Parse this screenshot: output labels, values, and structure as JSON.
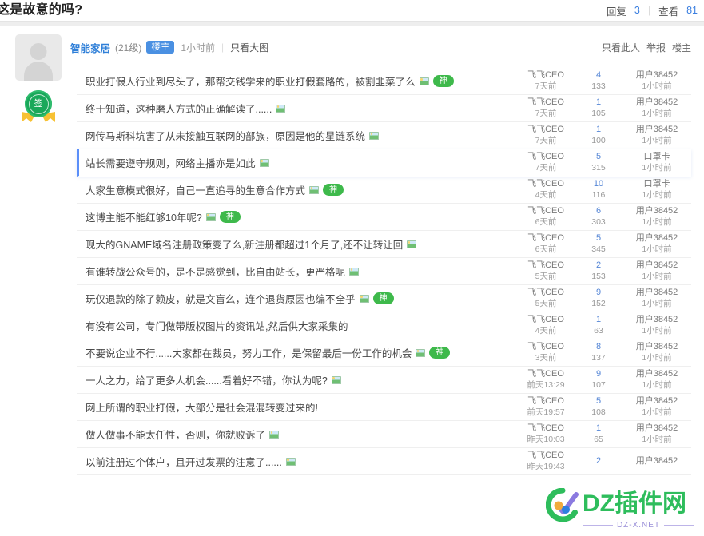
{
  "header": {
    "thread_title": "这是故意的吗?",
    "reply_label": "回复",
    "reply_count": "3",
    "view_label": "查看",
    "view_count": "81"
  },
  "post": {
    "author": "智能家居",
    "level": "(21级)",
    "lz_tag": "楼主",
    "time": "1小时前",
    "big_pic_link": "只看大图",
    "actions": {
      "only_this_user": "只看此人",
      "report": "举报",
      "lz": "楼主"
    },
    "avatar_name": "default-avatar",
    "badge_text": "签"
  },
  "colors": {
    "accent_blue": "#4a90e2",
    "link_blue": "#5586d6",
    "badge_green": "#3eb94b",
    "sign_green": "#1aa85a",
    "watermark_green": "#2ebd5c",
    "highlight_border": "#5b8ff9"
  },
  "threads": [
    {
      "title": "职业打假人行业到尽头了，那帮交钱学来的职业打假套路的，被割韭菜了么",
      "has_image": true,
      "god_badge": "神",
      "author": "飞飞CEO",
      "author_time": "7天前",
      "replies": "4",
      "views": "133",
      "last_user": "用户38452",
      "last_time": "1小时前",
      "active": false
    },
    {
      "title": "终于知道，这种磨人方式的正确解读了......",
      "has_image": true,
      "god_badge": "",
      "author": "飞飞CEO",
      "author_time": "7天前",
      "replies": "1",
      "views": "105",
      "last_user": "用户38452",
      "last_time": "1小时前",
      "active": false
    },
    {
      "title": "网传马斯科坑害了从未接触互联网的部族，原因是他的星链系统",
      "has_image": true,
      "god_badge": "",
      "author": "飞飞CEO",
      "author_time": "7天前",
      "replies": "1",
      "views": "100",
      "last_user": "用户38452",
      "last_time": "1小时前",
      "active": false
    },
    {
      "title": "站长需要遵守规则，网络主播亦是如此",
      "has_image": true,
      "god_badge": "",
      "author": "飞飞CEO",
      "author_time": "7天前",
      "replies": "5",
      "views": "315",
      "last_user": "口罩卡",
      "last_time": "1小时前",
      "active": true
    },
    {
      "title": "人家生意模式很好，自己一直追寻的生意合作方式",
      "has_image": true,
      "god_badge": "神",
      "author": "飞飞CEO",
      "author_time": "4天前",
      "replies": "10",
      "views": "116",
      "last_user": "口罩卡",
      "last_time": "1小时前",
      "active": false
    },
    {
      "title": "这博主能不能红够10年呢?",
      "has_image": true,
      "god_badge": "神",
      "author": "飞飞CEO",
      "author_time": "6天前",
      "replies": "6",
      "views": "303",
      "last_user": "用户38452",
      "last_time": "1小时前",
      "active": false
    },
    {
      "title": "现大的GNAME域名注册政策变了么,新注册都超过1个月了,还不让转让回",
      "has_image": true,
      "god_badge": "",
      "author": "飞飞CEO",
      "author_time": "6天前",
      "replies": "5",
      "views": "345",
      "last_user": "用户38452",
      "last_time": "1小时前",
      "active": false
    },
    {
      "title": "有谁转战公众号的，是不是感觉到，比自由站长，更严格呢",
      "has_image": true,
      "god_badge": "",
      "author": "飞飞CEO",
      "author_time": "5天前",
      "replies": "2",
      "views": "153",
      "last_user": "用户38452",
      "last_time": "1小时前",
      "active": false
    },
    {
      "title": "玩仅退款的除了赖皮，就是文盲么，连个退货原因也编不全乎",
      "has_image": true,
      "god_badge": "神",
      "author": "飞飞CEO",
      "author_time": "5天前",
      "replies": "9",
      "views": "152",
      "last_user": "用户38452",
      "last_time": "1小时前",
      "active": false
    },
    {
      "title": "有没有公司，专门做带版权图片的资讯站,然后供大家采集的",
      "has_image": false,
      "god_badge": "",
      "author": "飞飞CEO",
      "author_time": "4天前",
      "replies": "1",
      "views": "63",
      "last_user": "用户38452",
      "last_time": "1小时前",
      "active": false
    },
    {
      "title": "不要说企业不行......大家都在裁员，努力工作，是保留最后一份工作的机会",
      "has_image": true,
      "god_badge": "神",
      "author": "飞飞CEO",
      "author_time": "3天前",
      "replies": "8",
      "views": "137",
      "last_user": "用户38452",
      "last_time": "1小时前",
      "active": false
    },
    {
      "title": "一人之力，给了更多人机会......看着好不错，你认为呢?",
      "has_image": true,
      "god_badge": "",
      "author": "飞飞CEO",
      "author_time": "前天13:29",
      "replies": "9",
      "views": "107",
      "last_user": "用户38452",
      "last_time": "1小时前",
      "active": false
    },
    {
      "title": "网上所谓的职业打假，大部分是社会混混转变过来的!",
      "has_image": false,
      "god_badge": "",
      "author": "飞飞CEO",
      "author_time": "前天19:57",
      "replies": "5",
      "views": "108",
      "last_user": "用户38452",
      "last_time": "1小时前",
      "active": false
    },
    {
      "title": "做人做事不能太任性，否则，你就败诉了",
      "has_image": true,
      "god_badge": "",
      "author": "飞飞CEO",
      "author_time": "昨天10:03",
      "replies": "1",
      "views": "65",
      "last_user": "用户38452",
      "last_time": "1小时前",
      "active": false
    },
    {
      "title": "以前注册过个体户，且开过发票的注意了......",
      "has_image": true,
      "god_badge": "",
      "author": "飞飞CEO",
      "author_time": "昨天19:43",
      "replies": "2",
      "views": "",
      "last_user": "用户38452",
      "last_time": "",
      "active": false
    }
  ],
  "watermark": {
    "text_main": "DZ插件网",
    "text_sub": "DZ-X.NET"
  }
}
